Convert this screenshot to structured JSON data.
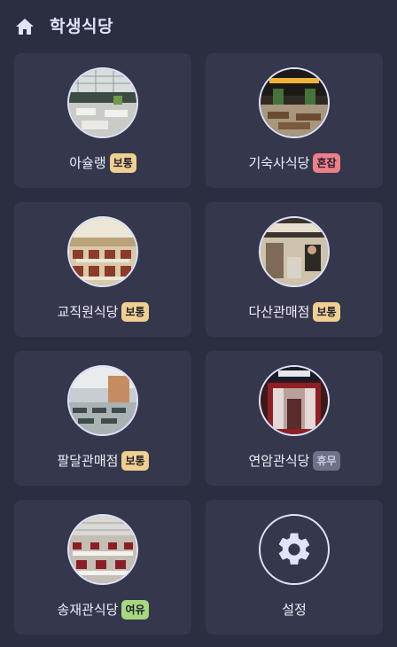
{
  "header": {
    "title": "학생식당",
    "home_icon": "home-icon"
  },
  "status_colors": {
    "보통": "#f0d08f",
    "혼잡": "#ee7f86",
    "휴무": "#6e7189",
    "여유": "#a6d87f"
  },
  "cafeterias": [
    {
      "name": "아슐랭",
      "status": "보통"
    },
    {
      "name": "기숙사식당",
      "status": "혼잡"
    },
    {
      "name": "교직원식당",
      "status": "보통"
    },
    {
      "name": "다산관매점",
      "status": "보통"
    },
    {
      "name": "팔달관매점",
      "status": "보통"
    },
    {
      "name": "연암관식당",
      "status": "휴무"
    },
    {
      "name": "송재관식당",
      "status": "여유"
    }
  ],
  "settings": {
    "label": "설정",
    "icon": "gear-icon"
  }
}
